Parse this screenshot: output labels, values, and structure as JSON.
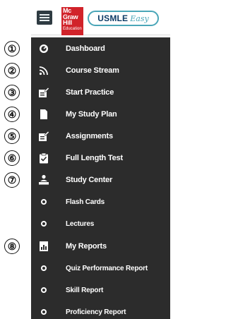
{
  "header": {
    "logo_lines": [
      "Mc",
      "Graw",
      "Hill",
      "Education"
    ],
    "product_usmle": "USMLE",
    "product_easy": "Easy"
  },
  "steps": [
    "①",
    "②",
    "③",
    "④",
    "⑤",
    "⑥",
    "⑦",
    "⑧"
  ],
  "menu": {
    "dashboard": "Dashboard",
    "course_stream": "Course Stream",
    "start_practice": "Start Practice",
    "my_study_plan": "My Study Plan",
    "assignments": "Assignments",
    "full_length_test": "Full Length Test",
    "study_center": "Study Center",
    "flash_cards": "Flash Cards",
    "lectures": "Lectures",
    "my_reports": "My Reports",
    "quiz_performance_report": "Quiz Performance Report",
    "skill_report": "Skill Report",
    "proficiency_report": "Proficiency Report"
  },
  "colors": {
    "sidebar_bg": "#2c2c2c",
    "brand_red": "#d1232a",
    "accent_teal": "#4aa6b8",
    "usmle_navy": "#0d3b66"
  }
}
